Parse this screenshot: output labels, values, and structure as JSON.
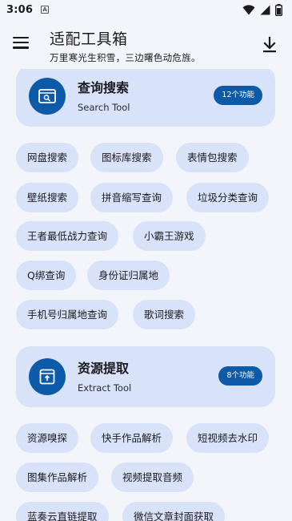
{
  "status_bar": {
    "time": "3:06",
    "a_icon_letter": "A",
    "icons": [
      "wifi-icon",
      "signal-icon",
      "battery-icon"
    ]
  },
  "app_bar": {
    "title": "适配工具箱",
    "subtitle": "万里寒光生积雪，三边曙色动危旌。",
    "menu_icon": "menu-icon",
    "download_icon": "download-icon"
  },
  "colors": {
    "background": "#f4f5fb",
    "card": "#d8e2f8",
    "chip": "#d8e2f8",
    "accent": "#0c5aa8",
    "text": "#1b1b1f"
  },
  "sections": [
    {
      "title": "查询搜索",
      "subtitle": "Search Tool",
      "badge": "12个功能",
      "icon": "search-window-icon",
      "chips": [
        "网盘搜索",
        "图标库搜索",
        "表情包搜索",
        "壁纸搜索",
        "拼音缩写查询",
        "垃圾分类查询",
        "王者最低战力查询",
        "小霸王游戏",
        "Q绑查询",
        "身份证归属地",
        "手机号归属地查询",
        "歌词搜索"
      ]
    },
    {
      "title": "资源提取",
      "subtitle": "Extract Tool",
      "badge": "8个功能",
      "icon": "extract-box-icon",
      "chips": [
        "资源嗅探",
        "快手作品解析",
        "短视频去水印",
        "图集作品解析",
        "视频提取音频",
        "蓝奏云直链提取",
        "微信文章封面获取"
      ]
    }
  ]
}
